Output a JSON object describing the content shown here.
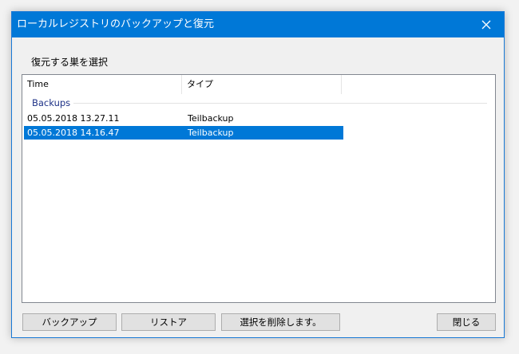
{
  "window": {
    "title": "ローカルレジストリのバックアップと復元",
    "close_icon": "close-icon"
  },
  "instruction": "復元する巣を選択",
  "list": {
    "columns": [
      "Time",
      "タイプ"
    ],
    "group": "Backups",
    "rows": [
      {
        "time": "05.05.2018 13.27.11",
        "type": "Teilbackup",
        "selected": false
      },
      {
        "time": "05.05.2018 14.16.47",
        "type": "Teilbackup",
        "selected": true
      }
    ]
  },
  "buttons": {
    "backup": "バックアップ",
    "restore": "リストア",
    "delete": "選択を削除します。",
    "close": "閉じる"
  },
  "colors": {
    "titlebar": "#0078d7",
    "selection": "#0078d7",
    "group_text": "#1e3287"
  }
}
